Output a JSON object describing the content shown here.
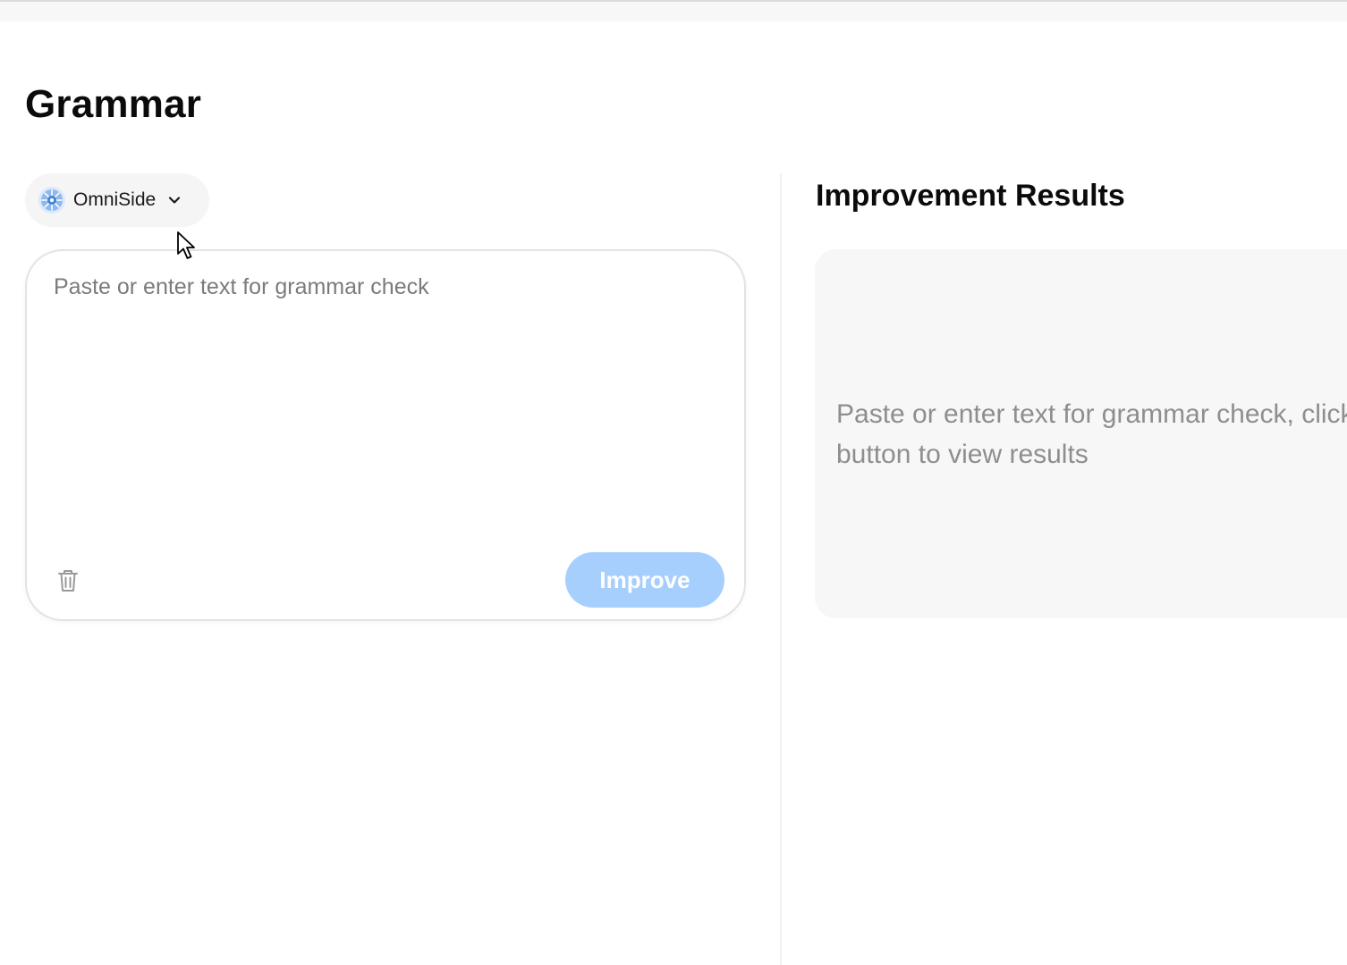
{
  "page": {
    "title": "Grammar"
  },
  "model_selector": {
    "label": "OmniSide",
    "icon": "omniside-logo-icon"
  },
  "editor": {
    "value": "",
    "placeholder": "Paste or enter text for grammar check",
    "clear_icon": "trash-icon",
    "improve_label": "Improve"
  },
  "results": {
    "title": "Improvement Results",
    "placeholder": "Paste or enter text for grammar check, click the button to view results"
  },
  "colors": {
    "improve_button": "#a7cffd",
    "results_panel_bg": "#f7f7f8",
    "model_selector_bg": "#f5f5f6"
  }
}
